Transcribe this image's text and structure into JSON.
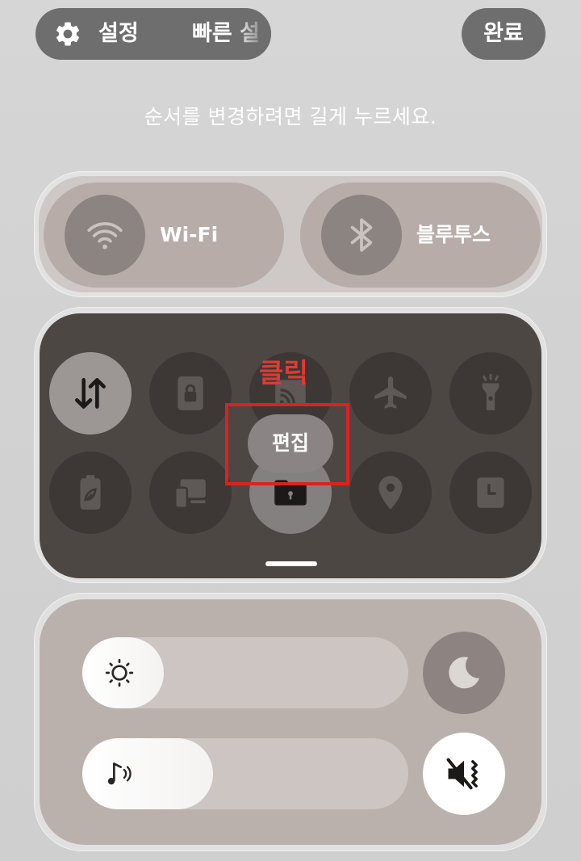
{
  "top_bar": {
    "settings_label": "설정",
    "quick_panel_label": "빠른 설",
    "done_label": "완료",
    "icons": [
      "gear-icon"
    ]
  },
  "instruction": "순서를 변경하려면 길게 누르세요.",
  "connectivity": {
    "wifi_label": "Wi-Fi",
    "bluetooth_label": "블루투스"
  },
  "quick_tiles": {
    "row1": [
      "data-transfer-icon",
      "lock-screen-icon",
      "cast-icon",
      "airplane-icon",
      "flashlight-icon"
    ],
    "row2": [
      "power-saving-icon",
      "device-control-icon",
      "secure-folder-icon",
      "location-icon",
      "clock-icon"
    ],
    "edit_label": "편집",
    "annotation_label": "클릭",
    "annotation_color": "#e02020"
  },
  "sliders": {
    "brightness_level": 0.25,
    "volume_level": 0.4
  },
  "colors": {
    "pill_bg": "#6e6e6e",
    "grid_bg": "#4d4744",
    "panel_bg": "#bbb1ac"
  }
}
